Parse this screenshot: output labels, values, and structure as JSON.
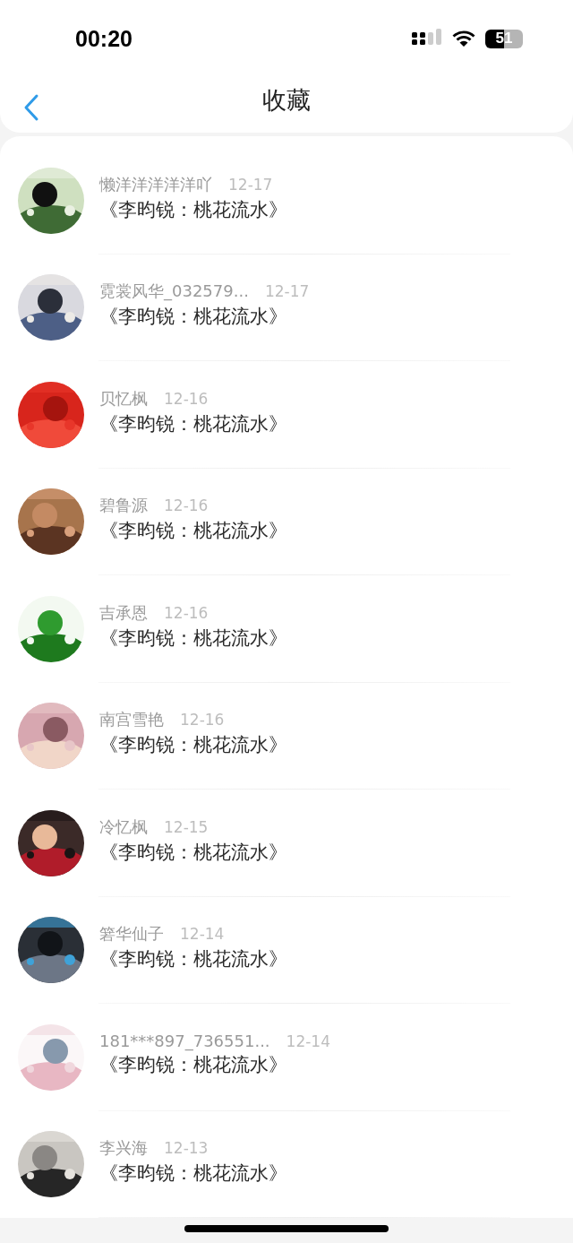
{
  "status_bar": {
    "time": "00:20",
    "battery": "51"
  },
  "nav": {
    "title": "收藏"
  },
  "items": [
    {
      "user": "懒洋洋洋洋洋吖",
      "date": "12-17",
      "title": "《李昀锐：桃花流水》"
    },
    {
      "user": "霓裳风华_032579...",
      "date": "12-17",
      "title": "《李昀锐：桃花流水》"
    },
    {
      "user": "贝忆枫",
      "date": "12-16",
      "title": "《李昀锐：桃花流水》"
    },
    {
      "user": "碧鲁源",
      "date": "12-16",
      "title": "《李昀锐：桃花流水》"
    },
    {
      "user": "吉承恩",
      "date": "12-16",
      "title": "《李昀锐：桃花流水》"
    },
    {
      "user": "南宫雪艳",
      "date": "12-16",
      "title": "《李昀锐：桃花流水》"
    },
    {
      "user": "冷忆枫",
      "date": "12-15",
      "title": "《李昀锐：桃花流水》"
    },
    {
      "user": "箬华仙子",
      "date": "12-14",
      "title": "《李昀锐：桃花流水》"
    },
    {
      "user": "181***897_736551...",
      "date": "12-14",
      "title": "《李昀锐：桃花流水》"
    },
    {
      "user": "李兴海",
      "date": "12-13",
      "title": "《李昀锐：桃花流水》"
    }
  ]
}
